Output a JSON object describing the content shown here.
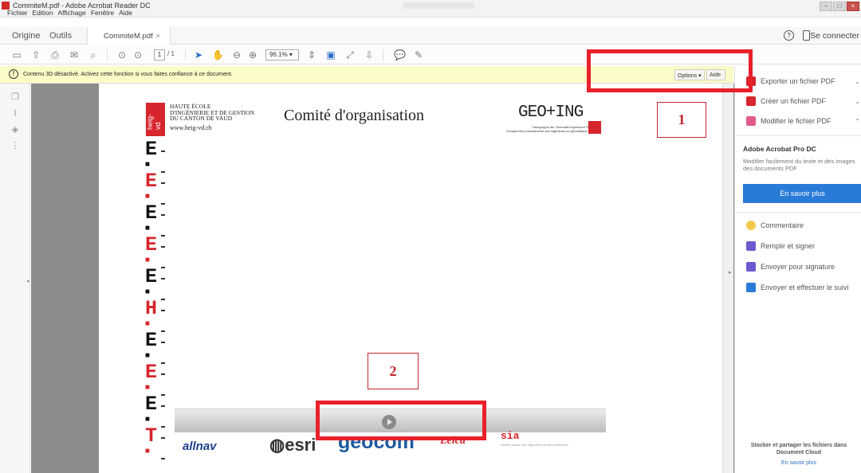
{
  "window": {
    "title": "CommiteM.pdf - Adobe Acrobat Reader DC",
    "menus": [
      "Fichier",
      "Edition",
      "Affichage",
      "Fenêtre",
      "Aide"
    ]
  },
  "tabs": {
    "home": "Origine",
    "tools": "Outils",
    "document": "CommiteM.pdf",
    "close": "×",
    "help": "?",
    "signin": "Se connecter"
  },
  "toolbar": {
    "page_current": "1",
    "page_total": "/ 1",
    "zoom": "96.1%"
  },
  "notice": {
    "icon": "!",
    "text": "Contenu 3D désactivé. Activez cette fonction si vous faites confiance à ce document.",
    "options": "Options ▾",
    "aide": "Aide"
  },
  "document": {
    "school_lines": [
      "HAUTE ÉCOLE",
      "D'INGÉNIERIE ET DE GESTION",
      "DU CANTON DE VAUD"
    ],
    "school_url": "www.heig-vd.ch",
    "logo_text": "heig-vd",
    "title": "Comité d'organisation",
    "geo_logo": "GEO+ING",
    "geo_sub_1": "Fachgruppe der Geomatik Ingenieure Schweiz",
    "geo_sub_2": "Groupement professionnel des ingénieurs en géomatique Suisse",
    "ruler_letters": [
      {
        "ch": "E",
        "color": "blk"
      },
      {
        "ch": "E",
        "color": "red"
      },
      {
        "ch": "E",
        "color": "blk"
      },
      {
        "ch": "E",
        "color": "red"
      },
      {
        "ch": "E",
        "color": "blk"
      },
      {
        "ch": "H",
        "color": "red"
      },
      {
        "ch": "E",
        "color": "blk"
      },
      {
        "ch": "E",
        "color": "red"
      },
      {
        "ch": "E",
        "color": "blk"
      },
      {
        "ch": "T",
        "color": "red"
      }
    ],
    "sponsors": {
      "allnav": "allnav",
      "esri": "esri",
      "geocom": "geocom",
      "leica": "Leica",
      "sia": "sia",
      "sia_sub": "société suisse des ingénieurs et des architectes"
    }
  },
  "panel": {
    "items_top": [
      {
        "label": "Exporter un fichier PDF",
        "icon": "export-pdf-icon",
        "color": "#d6252d"
      },
      {
        "label": "Créer un fichier PDF",
        "icon": "create-pdf-icon",
        "color": "#d6252d"
      },
      {
        "label": "Modifier le fichier PDF",
        "icon": "edit-pdf-icon",
        "color": "#e25b8a"
      }
    ],
    "pro_title": "Adobe Acrobat Pro DC",
    "pro_desc": "Modifier facilement du texte et des images des documents PDF",
    "learn_more": "En savoir plus",
    "items_bottom": [
      {
        "label": "Commentaire",
        "icon": "comment-icon",
        "color": "#f2c94c"
      },
      {
        "label": "Remplir et signer",
        "icon": "sign-icon",
        "color": "#6a5acd"
      },
      {
        "label": "Envoyer pour signature",
        "icon": "send-signature-icon",
        "color": "#6a5acd"
      },
      {
        "label": "Envoyer et effectuer le suivi",
        "icon": "send-track-icon",
        "color": "#2a7bd8"
      }
    ],
    "cloud_text": "Stocker et partager les fichiers dans Document Cloud",
    "cloud_link": "En savoir plus"
  },
  "annotations": {
    "label_1": "1",
    "label_2": "2",
    "color": "#e8212b"
  }
}
